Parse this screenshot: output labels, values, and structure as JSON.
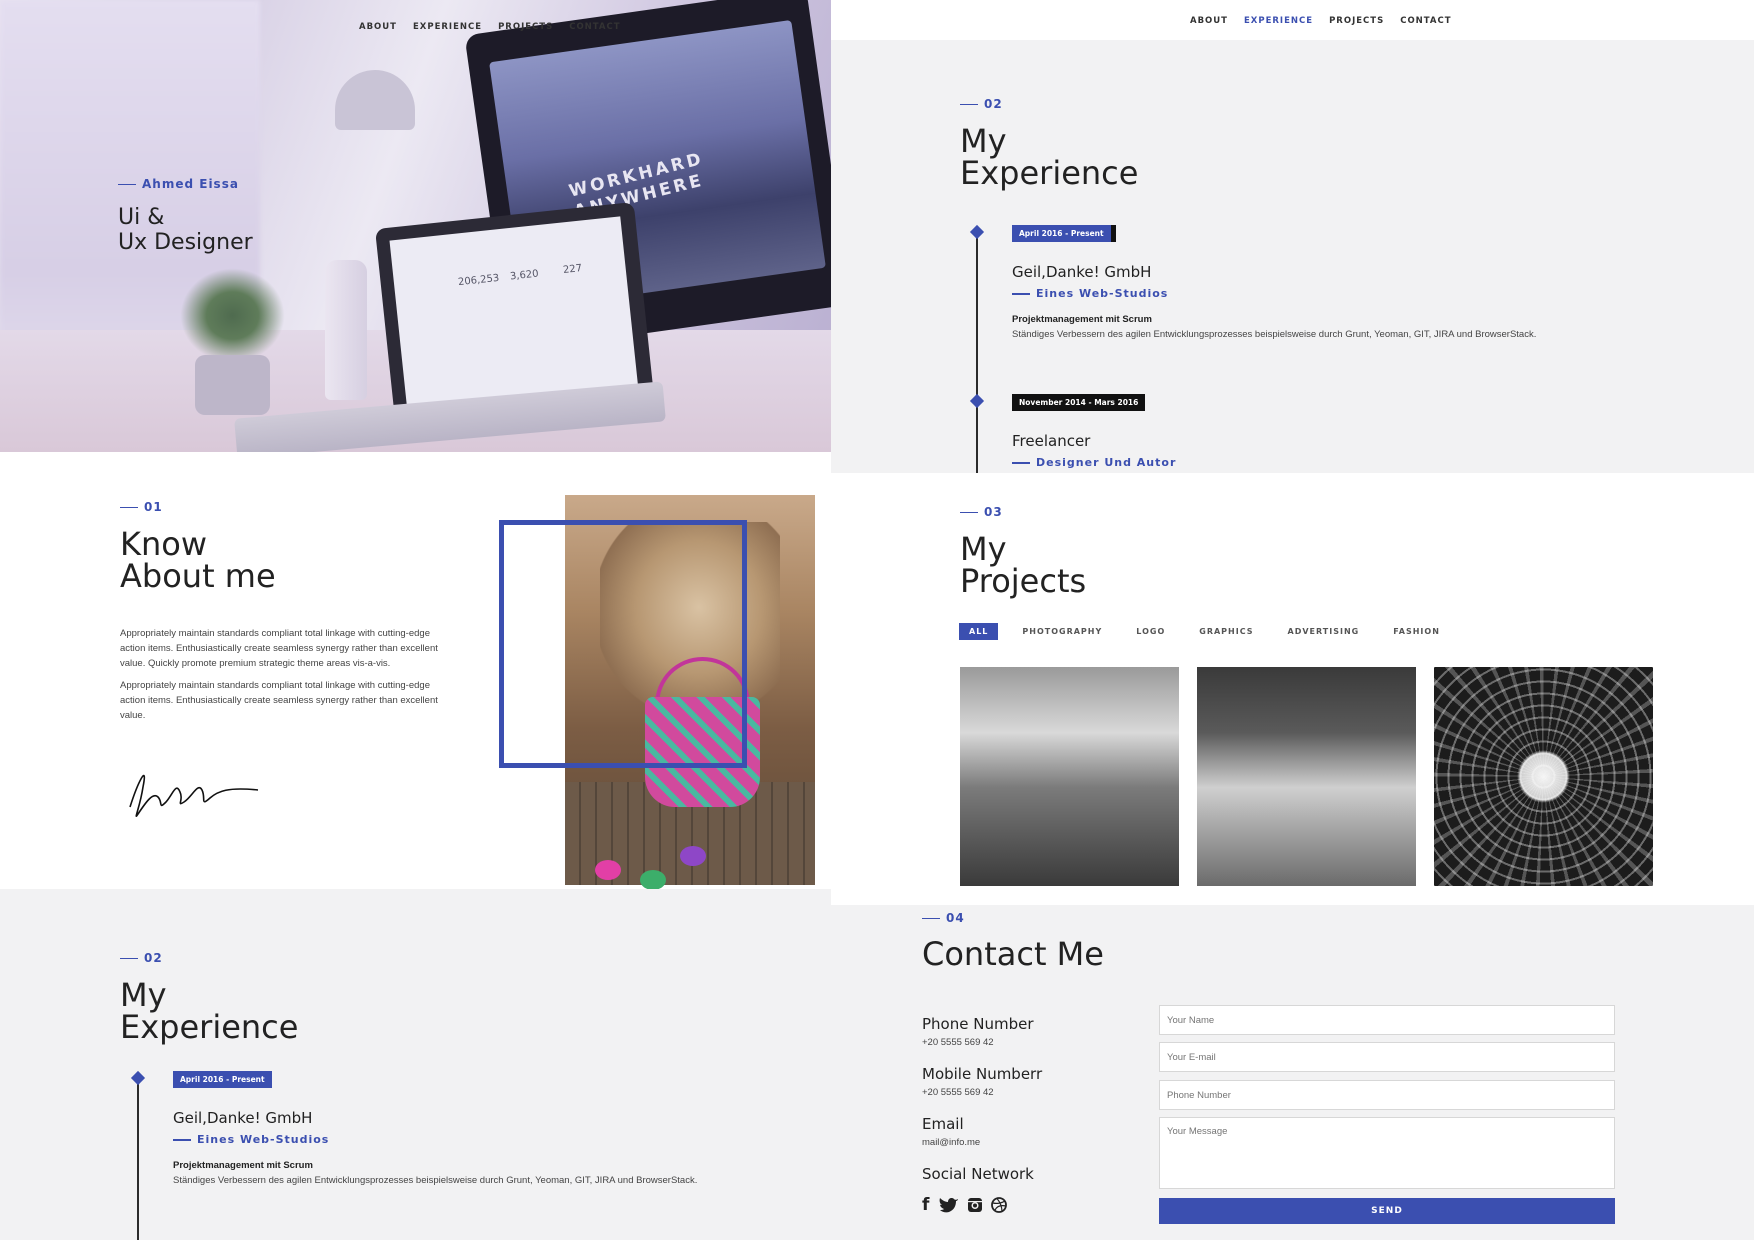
{
  "nav": {
    "about": "ABOUT",
    "experience": "EXPERIENCE",
    "projects": "PROJECTS",
    "contact": "CONTACT"
  },
  "hero": {
    "name": "Ahmed Eissa",
    "title_line1": "Ui &",
    "title_line2": "Ux Designer",
    "monitor_line1": "WORKHARD",
    "monitor_line2": "ANYWHERE",
    "stats": [
      "206,253",
      "3,620",
      "227"
    ]
  },
  "about": {
    "number": "01",
    "title_line1": "Know",
    "title_line2": "About me",
    "paragraph1": "Appropriately maintain standards compliant total linkage with cutting-edge action items. Enthusiastically create seamless synergy rather than excellent value. Quickly promote premium strategic theme areas vis-a-vis.",
    "paragraph2": "Appropriately maintain standards compliant total linkage with cutting-edge action items. Enthusiastically create seamless synergy rather than excellent value."
  },
  "experience": {
    "number": "02",
    "title_line1": "My",
    "title_line2": "Experience",
    "jobs": [
      {
        "period": "April 2016 - Present",
        "company": "Geil,Danke! GmbH",
        "role": "Eines Web-Studios",
        "heading": "Projektmanagement mit Scrum",
        "description": "Ständiges Verbessern des agilen Entwicklungsprozesses beispielsweise durch Grunt, Yeoman, GIT, JIRA und BrowserStack."
      },
      {
        "period": "November 2014 - Mars 2016",
        "company": "Freelancer",
        "role": "Designer Und Autor"
      }
    ]
  },
  "projects": {
    "number": "03",
    "title_line1": "My",
    "title_line2": "Projects",
    "filters": [
      "ALL",
      "PHOTOGRAPHY",
      "LOGO",
      "GRAPHICS",
      "ADVERTISING",
      "FASHION"
    ]
  },
  "contact": {
    "number": "04",
    "title": "Contact Me",
    "phone_label": "Phone Number",
    "phone_value": "+20 5555 569 42",
    "mobile_label": "Mobile Numberr",
    "mobile_value": "+20 5555 569 42",
    "email_label": "Email",
    "email_value": "mail@info.me",
    "social_label": "Social Network",
    "social_icons": [
      "facebook-icon",
      "twitter-icon",
      "instagram-icon",
      "dribbble-icon"
    ],
    "name_placeholder": "Your Name",
    "email_placeholder": "Your E-mail",
    "phone_placeholder": "Phone Number",
    "message_placeholder": "Your Message",
    "send_label": "SEND"
  },
  "colors": {
    "accent": "#3b4fb0",
    "dark": "#111111",
    "section_bg": "#f2f2f3"
  }
}
